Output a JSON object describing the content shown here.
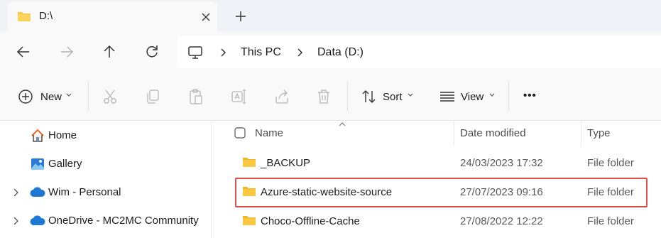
{
  "tab": {
    "title": "D:\\",
    "icon": "folder-icon",
    "close_icon": "close-icon",
    "new_tab_icon": "plus-icon"
  },
  "nav": {
    "back_icon": "arrow-left-icon",
    "forward_icon": "arrow-right-icon",
    "up_icon": "arrow-up-icon",
    "refresh_icon": "refresh-icon"
  },
  "address": {
    "root_icon": "monitor-icon",
    "breadcrumbs": [
      "This PC",
      "Data (D:)"
    ]
  },
  "commandbar": {
    "new_label": "New",
    "sort_label": "Sort",
    "view_label": "View",
    "more_label": "•••",
    "icons": [
      "plus-circle-icon",
      "cut-icon",
      "copy-icon",
      "paste-icon",
      "rename-icon",
      "share-icon",
      "delete-icon",
      "sort-icon",
      "view-icon",
      "more-icon"
    ]
  },
  "sidebar": {
    "items": [
      {
        "label": "Home",
        "icon": "home-icon",
        "expandable": false
      },
      {
        "label": "Gallery",
        "icon": "gallery-icon",
        "expandable": false
      },
      {
        "label": "Wim - Personal",
        "icon": "cloud-icon",
        "expandable": true
      },
      {
        "label": "OneDrive - MC2MC Community",
        "icon": "cloud-icon",
        "expandable": true
      }
    ]
  },
  "filelist": {
    "columns": [
      "Name",
      "Date modified",
      "Type"
    ],
    "rows": [
      {
        "name": "_BACKUP",
        "date": "24/03/2023 17:32",
        "type": "File folder"
      },
      {
        "name": "Azure-static-website-source",
        "date": "27/07/2023 09:16",
        "type": "File folder"
      },
      {
        "name": "Choco-Offline-Cache",
        "date": "27/08/2022 12:22",
        "type": "File folder"
      }
    ],
    "highlighted_row": "Azure-static-website-source"
  },
  "colors": {
    "folder": "#f8c842",
    "highlight_border": "#d9504e",
    "cloud": "#1f78d1",
    "home_roof": "#e06a2c"
  }
}
